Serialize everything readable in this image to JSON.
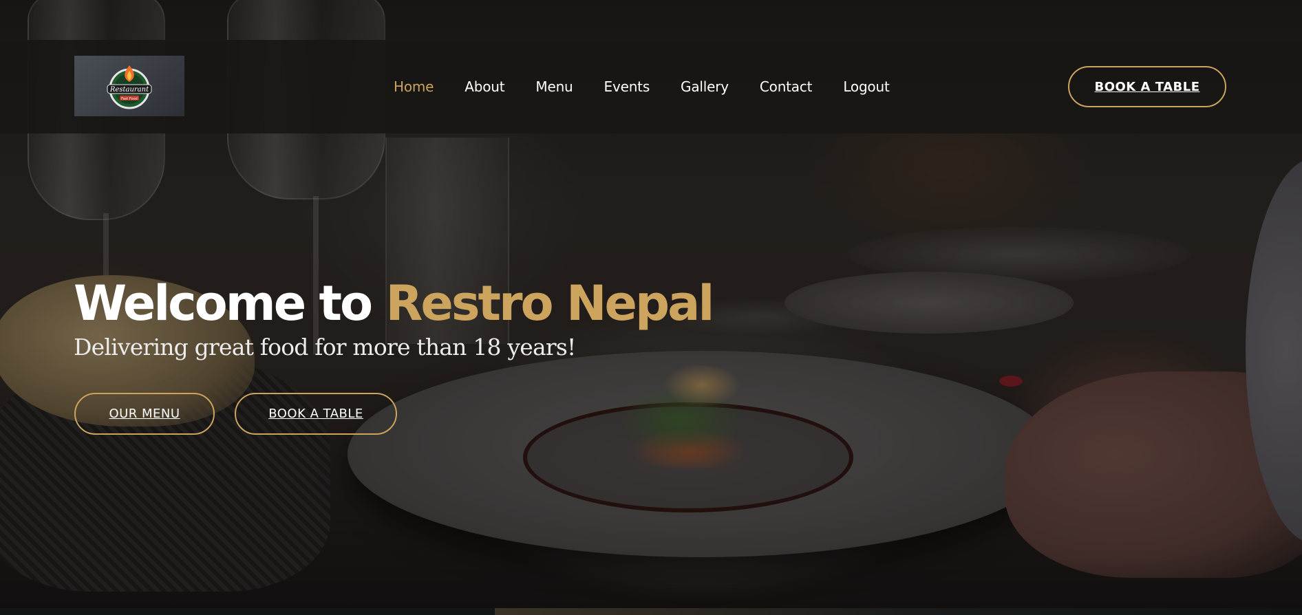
{
  "logo": {
    "alt": "Restaurant logo",
    "text": "Restaurant",
    "subtext": "Fast Food"
  },
  "nav": {
    "items": [
      {
        "label": "Home",
        "active": true
      },
      {
        "label": "About"
      },
      {
        "label": "Menu"
      },
      {
        "label": "Events"
      },
      {
        "label": "Gallery"
      },
      {
        "label": "Contact"
      },
      {
        "label": "Logout"
      }
    ],
    "book_button": "BOOK A TABLE"
  },
  "hero": {
    "title_prefix": "Welcome to ",
    "title_accent": "Restro Nepal",
    "subtitle": "Delivering great food for more than 18 years!",
    "menu_button": "OUR MENU",
    "book_button": "BOOK A TABLE"
  },
  "colors": {
    "accent": "#cda45e",
    "header_bg": "#181715",
    "text": "#ffffff"
  }
}
